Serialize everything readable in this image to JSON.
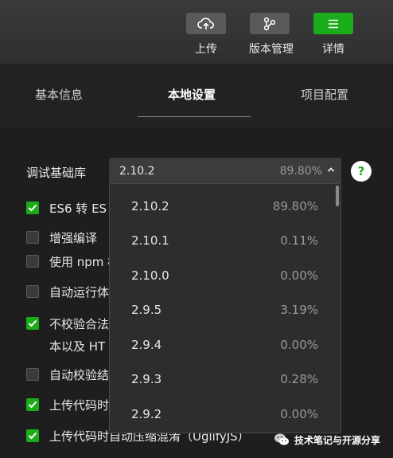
{
  "toolbar": {
    "upload_label": "上传",
    "version_label": "版本管理",
    "details_label": "详情"
  },
  "tabs": [
    {
      "label": "基本信息"
    },
    {
      "label": "本地设置",
      "active": true
    },
    {
      "label": "项目配置"
    }
  ],
  "base_lib": {
    "label": "调试基础库",
    "selected_version": "2.10.2",
    "selected_percent": "89.80%",
    "help": "?"
  },
  "options": [
    {
      "version": "2.10.2",
      "percent": "89.80%"
    },
    {
      "version": "2.10.1",
      "percent": "0.11%"
    },
    {
      "version": "2.10.0",
      "percent": "0.00%"
    },
    {
      "version": "2.9.5",
      "percent": "3.19%"
    },
    {
      "version": "2.9.4",
      "percent": "0.00%"
    },
    {
      "version": "2.9.3",
      "percent": "0.28%"
    },
    {
      "version": "2.9.2",
      "percent": "0.00%"
    }
  ],
  "settings": [
    {
      "label": "ES6 转 ES",
      "checked": true
    },
    {
      "label": "增强编译",
      "checked": false
    },
    {
      "label": "使用 npm 模",
      "checked": false
    },
    {
      "label": "自动运行体",
      "checked": false
    },
    {
      "label": "不校验合法",
      "line2": "本以及 HT",
      "checked": true
    },
    {
      "label": "自动校验结",
      "checked": false
    },
    {
      "label": "上传代码时",
      "checked": true
    },
    {
      "label": "上传代码时自动压缩混淆（UglifyJS）",
      "checked": true
    }
  ],
  "watermark": {
    "text": "技术笔记与开源分享"
  },
  "colors": {
    "accent": "#1aad19",
    "background": "#1e1e1e",
    "toolbar": "#333333"
  }
}
